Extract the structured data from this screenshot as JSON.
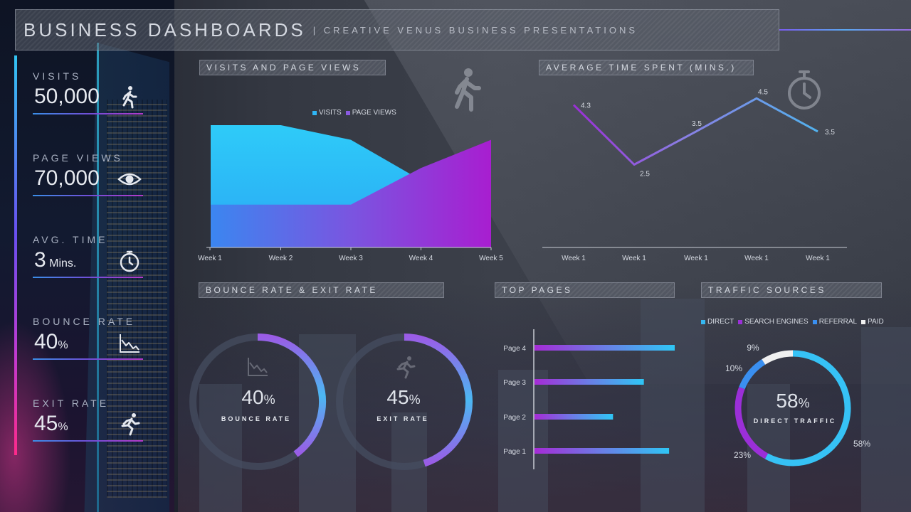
{
  "header": {
    "title": "BUSINESS DASHBOARDS",
    "subtitle": "| CREATIVE VENUS BUSINESS PRESENTATIONS"
  },
  "colors": {
    "cyan": "#2fc6f5",
    "blue": "#3a8ff0",
    "purple": "#9b2fd8",
    "magenta": "#b21fd0",
    "white": "#f0f0f0"
  },
  "kpis": [
    {
      "label": "VISITS",
      "value": "50,000",
      "unit": "",
      "icon": "walking-person-icon"
    },
    {
      "label": "PAGE VIEWS",
      "value": "70,000",
      "unit": "",
      "icon": "eye-icon"
    },
    {
      "label": "AVG. TIME",
      "value": "3",
      "unit": " Mins.",
      "icon": "stopwatch-icon"
    },
    {
      "label": "BOUNCE RATE",
      "value": "40",
      "unit": "%",
      "icon": "declining-chart-icon"
    },
    {
      "label": "EXIT RATE",
      "value": "45",
      "unit": "%",
      "icon": "running-person-icon"
    }
  ],
  "panels": {
    "visits_views": "VISITS AND PAGE VIEWS",
    "avg_time": "AVERAGE TIME SPENT (MINS.)",
    "bounce_exit": "BOUNCE RATE & EXIT RATE",
    "top_pages": "TOP PAGES",
    "traffic_sources": "TRAFFIC SOURCES"
  },
  "rings": {
    "bounce": {
      "value": "40",
      "unit": "%",
      "label": "BOUNCE RATE"
    },
    "exit": {
      "value": "45",
      "unit": "%",
      "label": "EXIT RATE"
    },
    "traffic": {
      "value": "58",
      "unit": "%",
      "label": "DIRECT TRAFFIC"
    }
  },
  "chart_data": [
    {
      "type": "area",
      "categories": [
        "Week 1",
        "Week 2",
        "Week 3",
        "Week 4",
        "Week 5"
      ],
      "series": [
        {
          "name": "VISITS",
          "values": [
            100,
            100,
            88,
            55,
            45
          ]
        },
        {
          "name": "PAGE VIEWS",
          "values": [
            35,
            35,
            35,
            65,
            88
          ]
        }
      ],
      "legend": "top-center"
    },
    {
      "type": "line",
      "categories": [
        "Week 1",
        "Week 1",
        "Week 1",
        "Week 1",
        "Week 1"
      ],
      "series": [
        {
          "values": [
            4.3,
            2.5,
            3.5,
            4.5,
            3.5
          ]
        }
      ],
      "data_labels": [
        "4.3",
        "2.5",
        "3.5",
        "4.5",
        "3.5"
      ],
      "ylim": [
        0,
        5.3
      ]
    },
    {
      "type": "bar",
      "orientation": "horizontal",
      "categories": [
        "Page 4",
        "Page 3",
        "Page 2",
        "Page 1"
      ],
      "values": [
        100,
        78,
        56,
        96
      ],
      "xlim": [
        0,
        100
      ]
    },
    {
      "type": "pie",
      "labels": [
        "DIRECT",
        "SEARCH ENGINES",
        "REFERRAL",
        "PAID"
      ],
      "values": [
        58,
        23,
        10,
        9
      ],
      "value_labels": [
        "58%",
        "23%",
        "10%",
        "9%"
      ],
      "legend": "top-right"
    },
    {
      "type": "pie",
      "labels": [
        "BOUNCE RATE"
      ],
      "values": [
        40
      ],
      "value_labels": [
        "40%"
      ]
    },
    {
      "type": "pie",
      "labels": [
        "EXIT RATE"
      ],
      "values": [
        45
      ],
      "value_labels": [
        "45%"
      ]
    }
  ]
}
